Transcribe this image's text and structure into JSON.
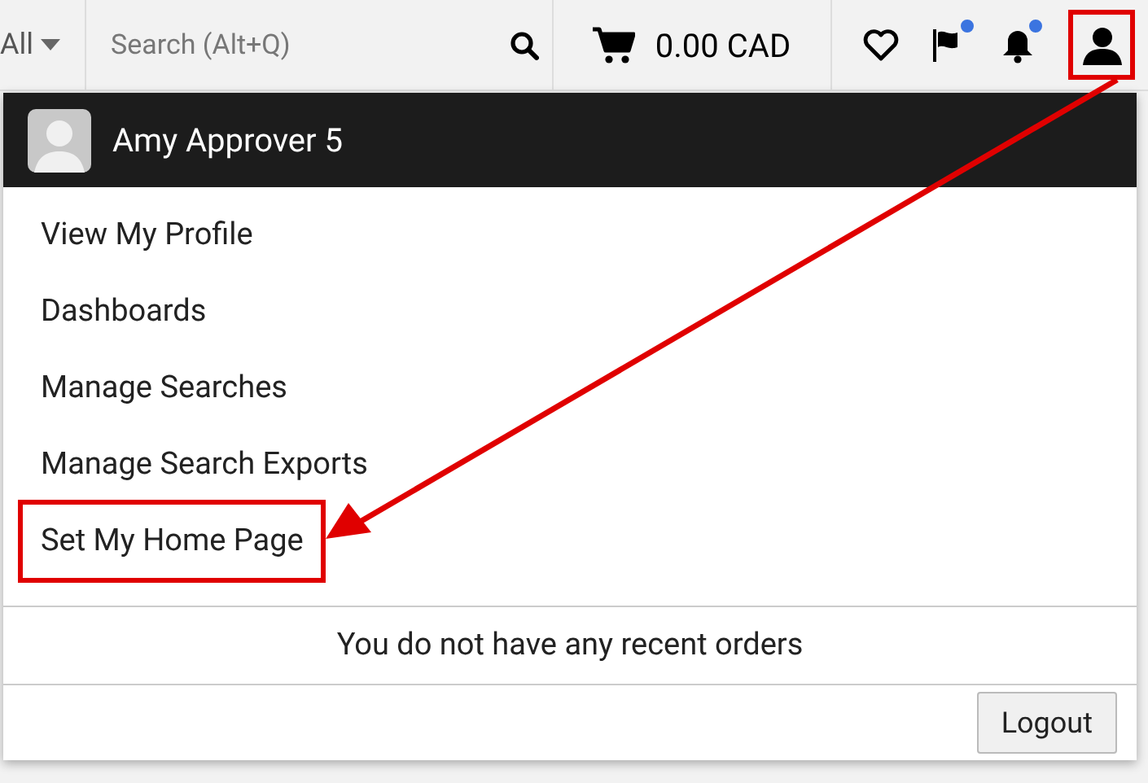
{
  "top_bar": {
    "scope": "All",
    "search": {
      "placeholder": "Search (Alt+Q)"
    },
    "cart_total": "0.00 CAD",
    "flag_unread": true,
    "bell_unread": true,
    "user_highlighted": true
  },
  "user_menu": {
    "name": "Amy Approver 5",
    "items": [
      {
        "label": "View My Profile",
        "highlighted": false
      },
      {
        "label": "Dashboards",
        "highlighted": false
      },
      {
        "label": "Manage Searches",
        "highlighted": false
      },
      {
        "label": "Manage Search Exports",
        "highlighted": false
      },
      {
        "label": "Set My Home Page",
        "highlighted": true
      }
    ],
    "recent_orders": "You do not have any recent orders",
    "logout": "Logout"
  },
  "annotation_arrow": true
}
